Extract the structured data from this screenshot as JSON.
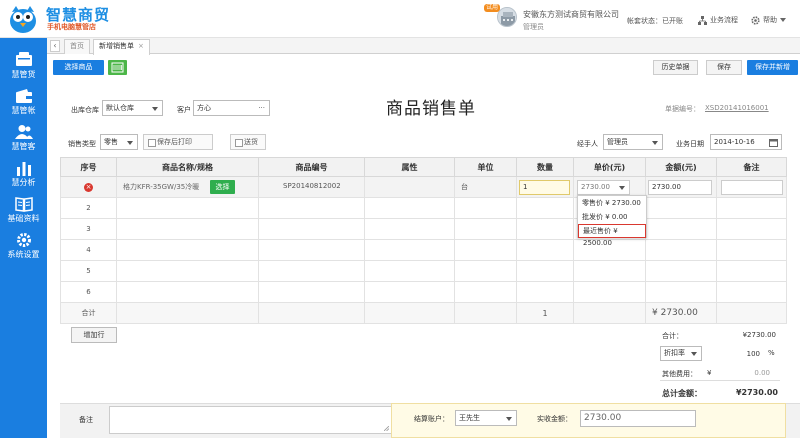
{
  "header": {
    "logo_title": "智慧商贸",
    "logo_subtitle": "手机电脑慧管店",
    "company_badge": "试用",
    "company_name": "安徽东方测试商贸有限公司",
    "user_role": "管理员",
    "account_status": "帐套状态：已开账",
    "business_flow": "业务流程",
    "help": "帮助"
  },
  "sidebar": {
    "items": [
      {
        "label": "慧管货"
      },
      {
        "label": "慧管帐"
      },
      {
        "label": "慧管客"
      },
      {
        "label": "慧分析"
      },
      {
        "label": "基础资料"
      },
      {
        "label": "系统设置"
      }
    ]
  },
  "tabs": {
    "arrow": "‹",
    "items": [
      {
        "label": "首页"
      },
      {
        "label": "新增销售单",
        "close": "×"
      }
    ]
  },
  "toolbar": {
    "select_goods": "选择商品",
    "history": "历史单据",
    "save": "保存",
    "save_new": "保存并新增"
  },
  "form": {
    "warehouse_label": "出库仓库",
    "warehouse_value": "默认仓库",
    "customer_label": "客户",
    "customer_value": "方心",
    "customer_more": "···",
    "title": "商品销售单",
    "docno_label": "单据编号：",
    "docno_value": "XSD20141016001",
    "sale_type_label": "销售类型",
    "sale_type_value": "零售",
    "print_after_save": "保存后打印",
    "delivery": "送货",
    "handler_label": "经手人",
    "handler_value": "管理员",
    "date_label": "业务日期",
    "date_value": "2014-10-16"
  },
  "table": {
    "headers": [
      "序号",
      "商品名称/规格",
      "商品编号",
      "属性",
      "单位",
      "数量",
      "单价(元)",
      "金额(元)",
      "备注"
    ],
    "first_row": {
      "delete": "×",
      "name": "格力KFR-35GW/35冷暖",
      "select_button": "选择",
      "code": "SP20140812002",
      "unit": "台",
      "qty": "1",
      "price": "2730.00",
      "amount": "2730.00"
    },
    "row_numbers": [
      "2",
      "3",
      "4",
      "5",
      "6"
    ],
    "total_label": "合计",
    "total_qty": "1",
    "total_amount": "¥ 2730.00"
  },
  "price_dropdown": {
    "options": [
      {
        "label": "零售价",
        "value": "¥ 2730.00"
      },
      {
        "label": "批发价",
        "value": "¥ 0.00"
      },
      {
        "label": "最近售价",
        "value": "¥ 2500.00"
      }
    ]
  },
  "summary": {
    "add_row": "增加行",
    "subtotal_label": "合计：",
    "subtotal_value": "¥2730.00",
    "discount_label": "折扣率",
    "discount_value": "100",
    "discount_unit": "%",
    "other_fee_label": "其他费用：",
    "other_fee_currency": "¥",
    "other_fee_value": "0.00",
    "grand_total_label": "总计金额：",
    "grand_total_value": "¥2730.00"
  },
  "footer": {
    "memo_label": "备注",
    "account_label": "结算账户：",
    "account_value": "王先生",
    "paid_label": "实收金额：",
    "paid_value": "2730.00"
  },
  "colors": {
    "brand_blue": "#1a7ee0",
    "accent_red": "#d9382f",
    "green": "#2fae4e"
  }
}
